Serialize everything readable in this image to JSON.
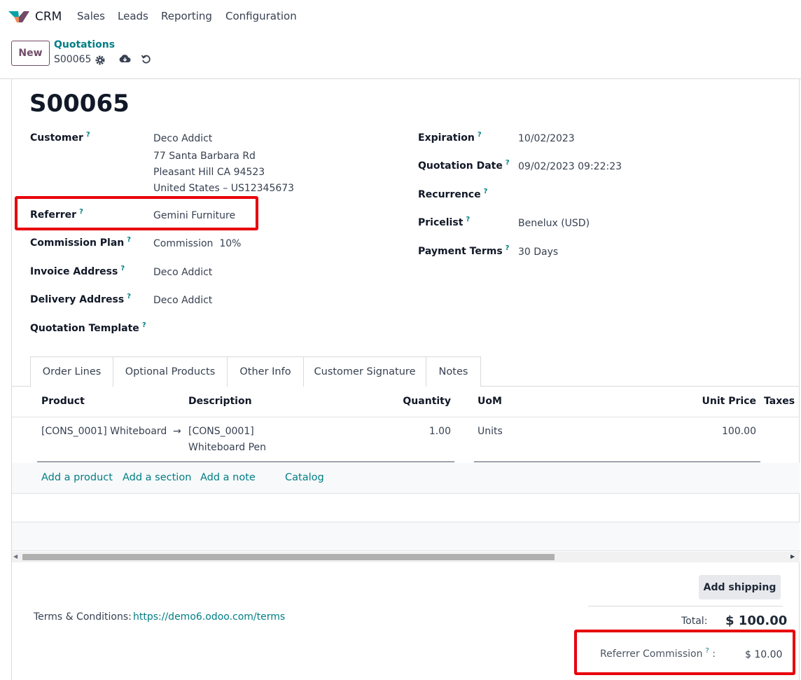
{
  "app": {
    "name": "CRM"
  },
  "nav": {
    "items": [
      "Sales",
      "Leads",
      "Reporting",
      "Configuration"
    ]
  },
  "control": {
    "new_label": "New",
    "breadcrumb_parent": "Quotations",
    "record_name": "S00065"
  },
  "form": {
    "title": "S00065",
    "left_fields": {
      "customer": {
        "label": "Customer",
        "name": "Deco Addict",
        "addr1": "77 Santa Barbara Rd",
        "addr2": "Pleasant Hill CA 94523",
        "addr3": "United States – US12345673"
      },
      "referrer": {
        "label": "Referrer",
        "value": "Gemini Furniture"
      },
      "commission_plan": {
        "label": "Commission Plan",
        "value": "Commission  10%"
      },
      "invoice_address": {
        "label": "Invoice Address",
        "value": "Deco Addict"
      },
      "delivery_address": {
        "label": "Delivery Address",
        "value": "Deco Addict"
      },
      "quotation_template": {
        "label": "Quotation Template",
        "value": ""
      }
    },
    "right_fields": {
      "expiration": {
        "label": "Expiration",
        "value": "10/02/2023"
      },
      "quotation_date": {
        "label": "Quotation Date",
        "value": "09/02/2023 09:22:23"
      },
      "recurrence": {
        "label": "Recurrence",
        "value": ""
      },
      "pricelist": {
        "label": "Pricelist",
        "value": "Benelux (USD)"
      },
      "payment_terms": {
        "label": "Payment Terms",
        "value": "30 Days"
      }
    },
    "help_mark": "?"
  },
  "tabs": [
    "Order Lines",
    "Optional Products",
    "Other Info",
    "Customer Signature",
    "Notes"
  ],
  "order_lines": {
    "columns": {
      "product": "Product",
      "description": "Description",
      "quantity": "Quantity",
      "uom": "UoM",
      "unit_price": "Unit Price",
      "taxes": "Taxes"
    },
    "rows": [
      {
        "product": "[CONS_0001] Whiteboard",
        "desc1": "[CONS_0001]",
        "desc2": "Whiteboard Pen",
        "quantity": "1.00",
        "uom": "Units",
        "unit_price": "100.00"
      }
    ],
    "actions": {
      "add_product": "Add a product",
      "add_section": "Add a section",
      "add_note": "Add a note",
      "catalog": "Catalog"
    }
  },
  "footer": {
    "add_shipping": "Add shipping",
    "terms_label": "Terms & Conditions:",
    "terms_link": "https://demo6.odoo.com/terms",
    "total_label": "Total:",
    "total_value": "$ 100.00",
    "commission_label": "Referrer Commission",
    "commission_value": "$ 10.00"
  },
  "colors": {
    "accent": "#017e84",
    "brand": "#714b67",
    "highlight": "#e8000b"
  }
}
